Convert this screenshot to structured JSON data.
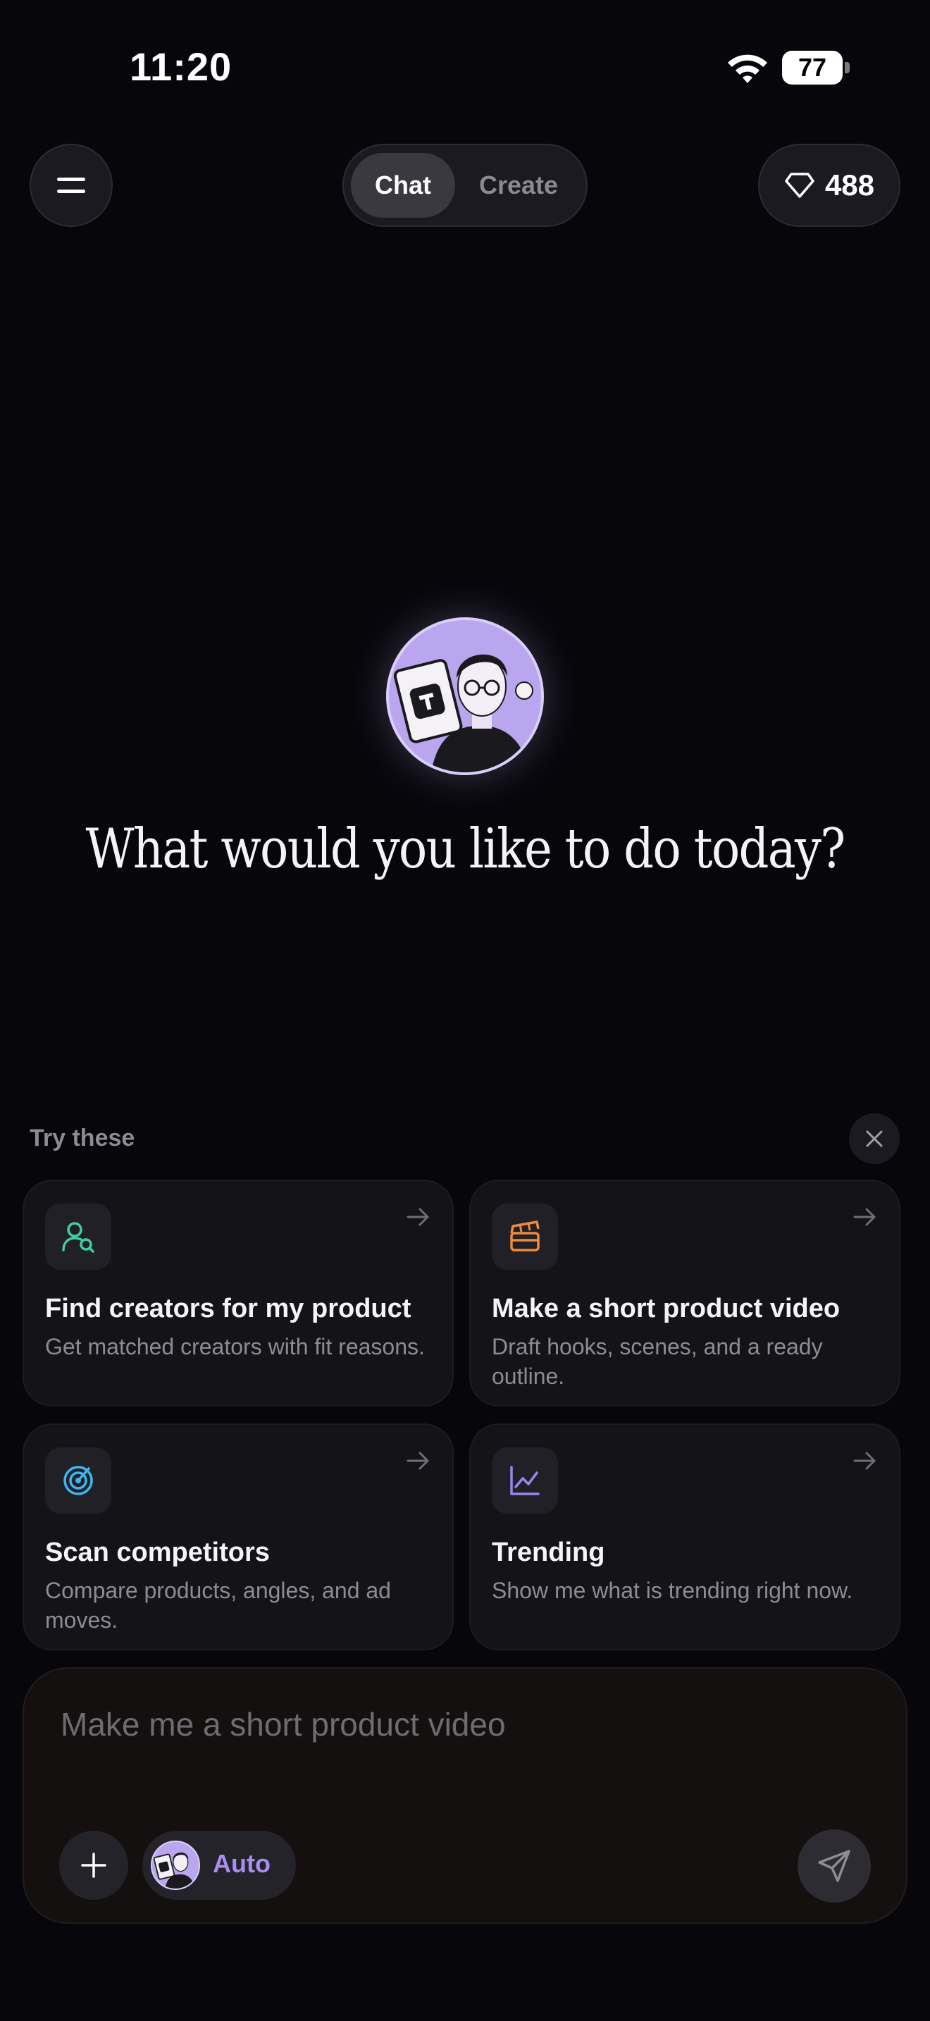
{
  "status_bar": {
    "time": "11:20",
    "battery": "77"
  },
  "header": {
    "tabs": [
      {
        "label": "Chat",
        "selected": true
      },
      {
        "label": "Create",
        "selected": false
      }
    ],
    "gems_count": "488"
  },
  "hero": {
    "headline": "What would you like to do today?"
  },
  "suggestions": {
    "heading": "Try these",
    "cards": [
      {
        "title": "Find creators for my product",
        "subtitle": "Get matched creators with fit reasons.",
        "icon": "user-search-icon",
        "color": "#3ecf9a"
      },
      {
        "title": "Make a short product video",
        "subtitle": "Draft hooks, scenes, and a ready outline.",
        "icon": "clapperboard-icon",
        "color": "#f08a3c"
      },
      {
        "title": "Scan competitors",
        "subtitle": "Compare products, angles, and ad moves.",
        "icon": "radar-icon",
        "color": "#3fb6ee"
      },
      {
        "title": "Trending",
        "subtitle": "Show me what is trending right now.",
        "icon": "trend-chart-icon",
        "color": "#9b86f0"
      }
    ]
  },
  "composer": {
    "placeholder": "Make me a short product video",
    "model_label": "Auto"
  },
  "colors": {
    "background": "#07060b",
    "accent": "#a98df0",
    "card": "#141318"
  }
}
